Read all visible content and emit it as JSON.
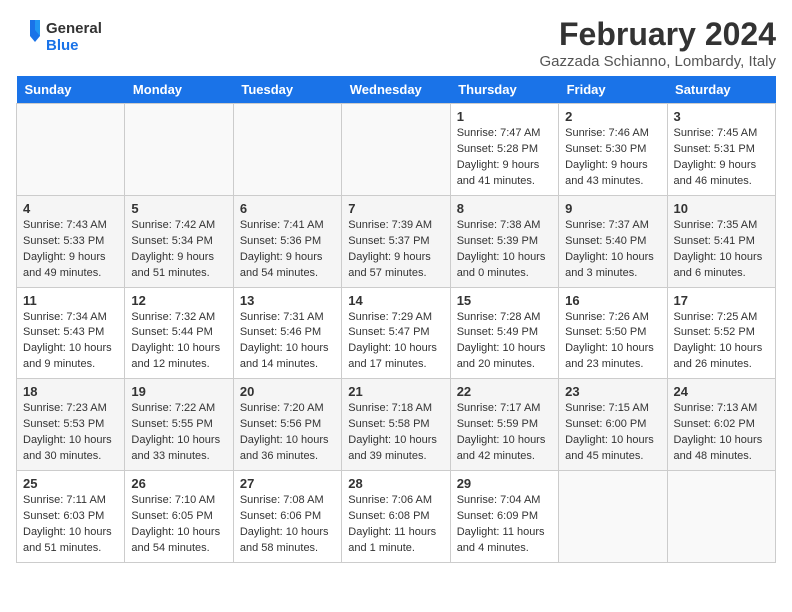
{
  "logo": {
    "line1": "General",
    "line2": "Blue"
  },
  "title": "February 2024",
  "location": "Gazzada Schianno, Lombardy, Italy",
  "days_of_week": [
    "Sunday",
    "Monday",
    "Tuesday",
    "Wednesday",
    "Thursday",
    "Friday",
    "Saturday"
  ],
  "weeks": [
    [
      {
        "num": "",
        "info": ""
      },
      {
        "num": "",
        "info": ""
      },
      {
        "num": "",
        "info": ""
      },
      {
        "num": "",
        "info": ""
      },
      {
        "num": "1",
        "info": "Sunrise: 7:47 AM\nSunset: 5:28 PM\nDaylight: 9 hours\nand 41 minutes."
      },
      {
        "num": "2",
        "info": "Sunrise: 7:46 AM\nSunset: 5:30 PM\nDaylight: 9 hours\nand 43 minutes."
      },
      {
        "num": "3",
        "info": "Sunrise: 7:45 AM\nSunset: 5:31 PM\nDaylight: 9 hours\nand 46 minutes."
      }
    ],
    [
      {
        "num": "4",
        "info": "Sunrise: 7:43 AM\nSunset: 5:33 PM\nDaylight: 9 hours\nand 49 minutes."
      },
      {
        "num": "5",
        "info": "Sunrise: 7:42 AM\nSunset: 5:34 PM\nDaylight: 9 hours\nand 51 minutes."
      },
      {
        "num": "6",
        "info": "Sunrise: 7:41 AM\nSunset: 5:36 PM\nDaylight: 9 hours\nand 54 minutes."
      },
      {
        "num": "7",
        "info": "Sunrise: 7:39 AM\nSunset: 5:37 PM\nDaylight: 9 hours\nand 57 minutes."
      },
      {
        "num": "8",
        "info": "Sunrise: 7:38 AM\nSunset: 5:39 PM\nDaylight: 10 hours\nand 0 minutes."
      },
      {
        "num": "9",
        "info": "Sunrise: 7:37 AM\nSunset: 5:40 PM\nDaylight: 10 hours\nand 3 minutes."
      },
      {
        "num": "10",
        "info": "Sunrise: 7:35 AM\nSunset: 5:41 PM\nDaylight: 10 hours\nand 6 minutes."
      }
    ],
    [
      {
        "num": "11",
        "info": "Sunrise: 7:34 AM\nSunset: 5:43 PM\nDaylight: 10 hours\nand 9 minutes."
      },
      {
        "num": "12",
        "info": "Sunrise: 7:32 AM\nSunset: 5:44 PM\nDaylight: 10 hours\nand 12 minutes."
      },
      {
        "num": "13",
        "info": "Sunrise: 7:31 AM\nSunset: 5:46 PM\nDaylight: 10 hours\nand 14 minutes."
      },
      {
        "num": "14",
        "info": "Sunrise: 7:29 AM\nSunset: 5:47 PM\nDaylight: 10 hours\nand 17 minutes."
      },
      {
        "num": "15",
        "info": "Sunrise: 7:28 AM\nSunset: 5:49 PM\nDaylight: 10 hours\nand 20 minutes."
      },
      {
        "num": "16",
        "info": "Sunrise: 7:26 AM\nSunset: 5:50 PM\nDaylight: 10 hours\nand 23 minutes."
      },
      {
        "num": "17",
        "info": "Sunrise: 7:25 AM\nSunset: 5:52 PM\nDaylight: 10 hours\nand 26 minutes."
      }
    ],
    [
      {
        "num": "18",
        "info": "Sunrise: 7:23 AM\nSunset: 5:53 PM\nDaylight: 10 hours\nand 30 minutes."
      },
      {
        "num": "19",
        "info": "Sunrise: 7:22 AM\nSunset: 5:55 PM\nDaylight: 10 hours\nand 33 minutes."
      },
      {
        "num": "20",
        "info": "Sunrise: 7:20 AM\nSunset: 5:56 PM\nDaylight: 10 hours\nand 36 minutes."
      },
      {
        "num": "21",
        "info": "Sunrise: 7:18 AM\nSunset: 5:58 PM\nDaylight: 10 hours\nand 39 minutes."
      },
      {
        "num": "22",
        "info": "Sunrise: 7:17 AM\nSunset: 5:59 PM\nDaylight: 10 hours\nand 42 minutes."
      },
      {
        "num": "23",
        "info": "Sunrise: 7:15 AM\nSunset: 6:00 PM\nDaylight: 10 hours\nand 45 minutes."
      },
      {
        "num": "24",
        "info": "Sunrise: 7:13 AM\nSunset: 6:02 PM\nDaylight: 10 hours\nand 48 minutes."
      }
    ],
    [
      {
        "num": "25",
        "info": "Sunrise: 7:11 AM\nSunset: 6:03 PM\nDaylight: 10 hours\nand 51 minutes."
      },
      {
        "num": "26",
        "info": "Sunrise: 7:10 AM\nSunset: 6:05 PM\nDaylight: 10 hours\nand 54 minutes."
      },
      {
        "num": "27",
        "info": "Sunrise: 7:08 AM\nSunset: 6:06 PM\nDaylight: 10 hours\nand 58 minutes."
      },
      {
        "num": "28",
        "info": "Sunrise: 7:06 AM\nSunset: 6:08 PM\nDaylight: 11 hours\nand 1 minute."
      },
      {
        "num": "29",
        "info": "Sunrise: 7:04 AM\nSunset: 6:09 PM\nDaylight: 11 hours\nand 4 minutes."
      },
      {
        "num": "",
        "info": ""
      },
      {
        "num": "",
        "info": ""
      }
    ]
  ]
}
